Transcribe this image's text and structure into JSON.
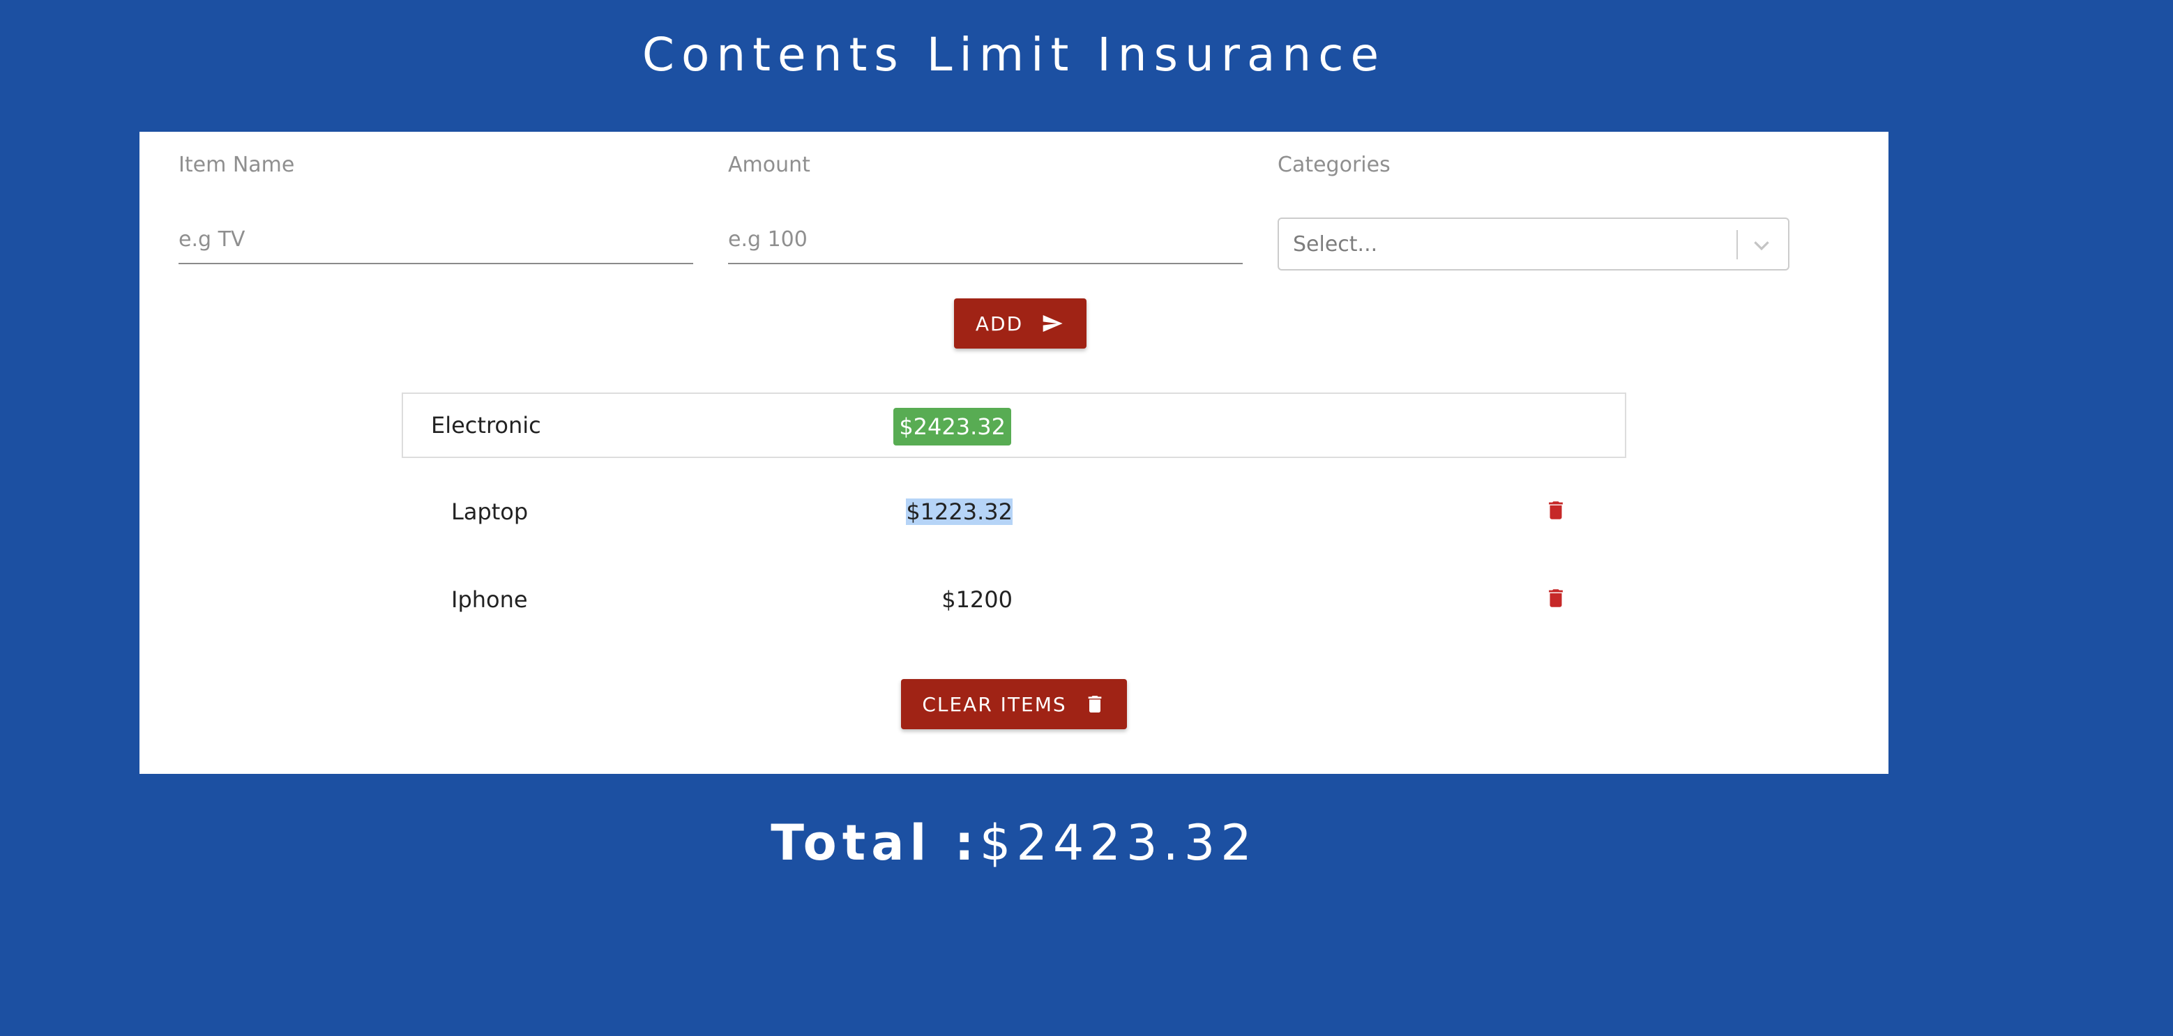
{
  "header": {
    "title": "Contents Limit Insurance"
  },
  "form": {
    "item_name": {
      "label": "Item Name",
      "placeholder": "e.g TV",
      "value": ""
    },
    "amount": {
      "label": "Amount",
      "placeholder": "e.g 100",
      "value": ""
    },
    "categories": {
      "label": "Categories",
      "selected_text": "Select..."
    },
    "add_button": {
      "label": "ADD",
      "icon": "send-icon"
    }
  },
  "category_group": {
    "name": "Electronic",
    "total": "$2423.32",
    "badge_color": "#58ac53"
  },
  "items": [
    {
      "name": "Laptop",
      "amount": "$1223.32",
      "selected": true
    },
    {
      "name": "Iphone",
      "amount": "$1200",
      "selected": false
    }
  ],
  "clear_button": {
    "label": "CLEAR ITEMS",
    "icon": "trash-icon"
  },
  "footer": {
    "total_label": "Total :",
    "total_value": "$2423.32"
  },
  "colors": {
    "background": "#1c50a2",
    "button": "#a02315",
    "delete_icon": "#c62828",
    "badge": "#58ac53"
  }
}
